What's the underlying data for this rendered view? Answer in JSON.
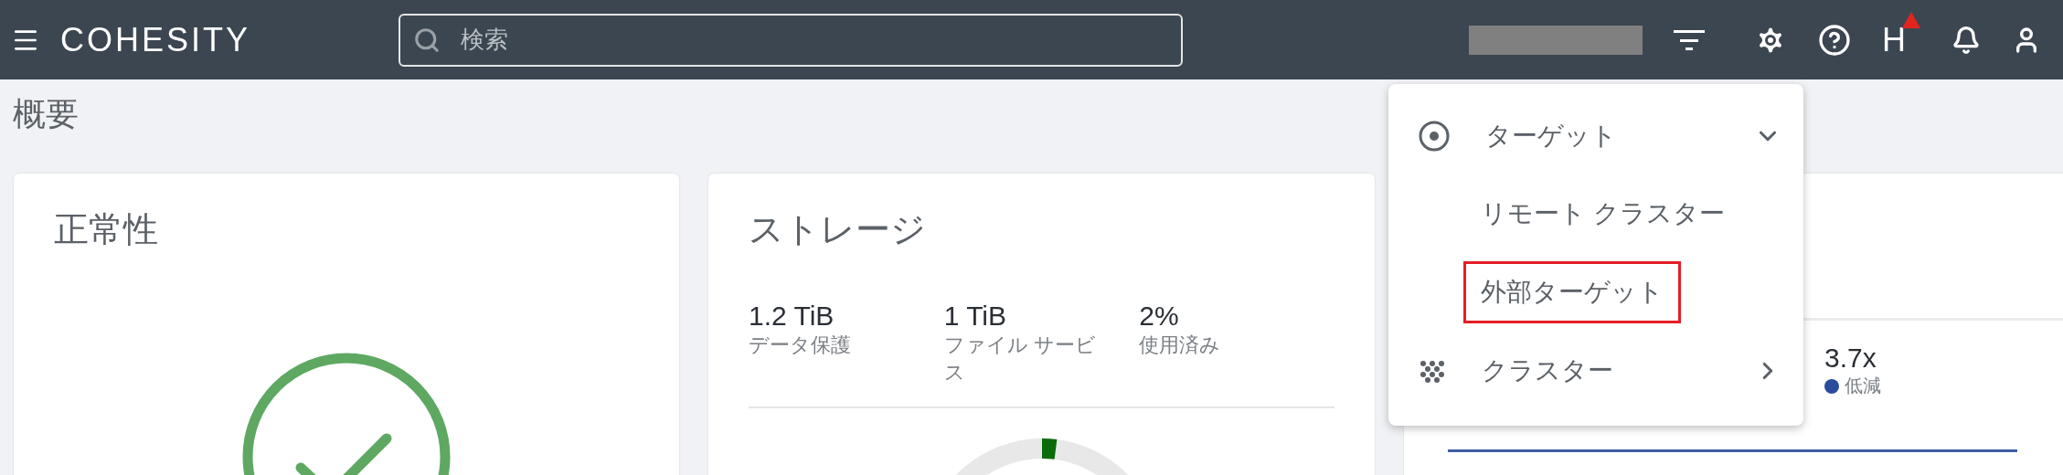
{
  "header": {
    "logo": "COHESITY",
    "search": {
      "placeholder": "検索"
    },
    "user_initial": "H",
    "alert": true
  },
  "page_title": "概要",
  "cards": [
    {
      "kind": "health",
      "title": "正常性"
    },
    {
      "kind": "storage",
      "title": "ストレージ",
      "stats": [
        {
          "value": "1.2 TiB",
          "label": "データ保護"
        },
        {
          "value": "1 TiB",
          "label": "ファイル サービス"
        },
        {
          "value": "2%",
          "label": "使用済み"
        }
      ],
      "usage_ring": {
        "level": 0.02
      }
    },
    {
      "kind": "reduction",
      "stat": {
        "value": "3.7x",
        "label": "低減",
        "color": "#2b4c9b"
      }
    }
  ],
  "menu": {
    "items": [
      {
        "kind": "group",
        "label": "ターゲット",
        "expanded": true,
        "children": [
          {
            "label": "リモート クラスター",
            "highlighted": false
          },
          {
            "label": "外部ターゲット",
            "highlighted": true
          }
        ]
      },
      {
        "kind": "submenu",
        "label": "クラスター"
      }
    ]
  }
}
